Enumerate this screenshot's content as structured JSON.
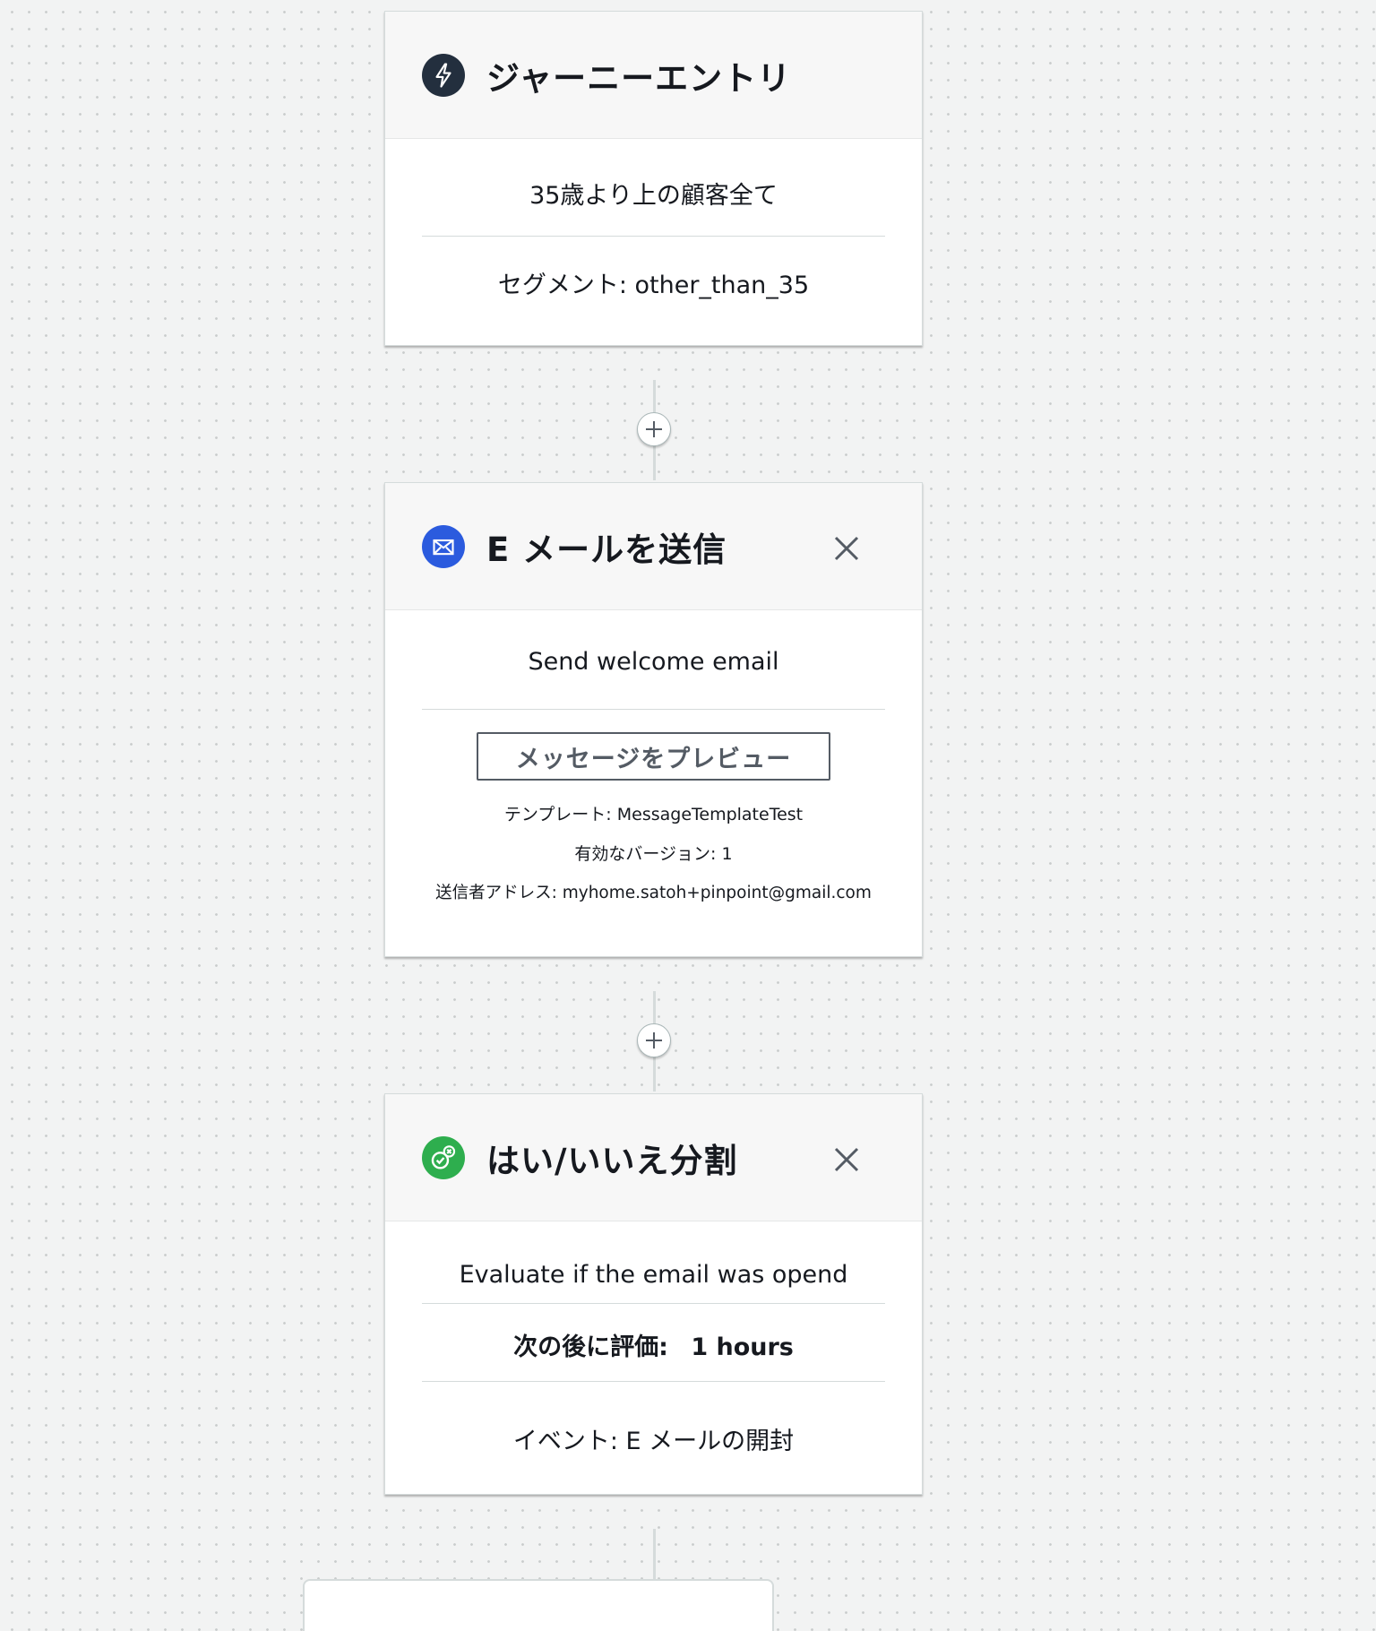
{
  "entry": {
    "title": "ジャーニーエントリ",
    "description": "35歳より上の顧客全て",
    "segment": "セグメント: other_than_35"
  },
  "email": {
    "title": "E メールを送信",
    "description": "Send welcome email",
    "preview_button": "メッセージをプレビュー",
    "template": "テンプレート: MessageTemplateTest",
    "version": "有効なバージョン: 1",
    "sender": "送信者アドレス: myhome.satoh+pinpoint@gmail.com"
  },
  "split": {
    "title": "はい/いいえ分割",
    "description": "Evaluate if the email was opend",
    "evaluate_label": "次の後に評価:",
    "evaluate_value": "1 hours",
    "event": "イベント:  E メールの開封"
  },
  "colors": {
    "entry_icon": "#232f3e",
    "email_icon": "#2b5bde",
    "split_icon": "#2eae4e"
  },
  "icons": {
    "entry": "lightning-icon",
    "email": "envelope-icon",
    "split": "check-cross-icon",
    "close": "close-icon",
    "add": "plus-icon"
  }
}
